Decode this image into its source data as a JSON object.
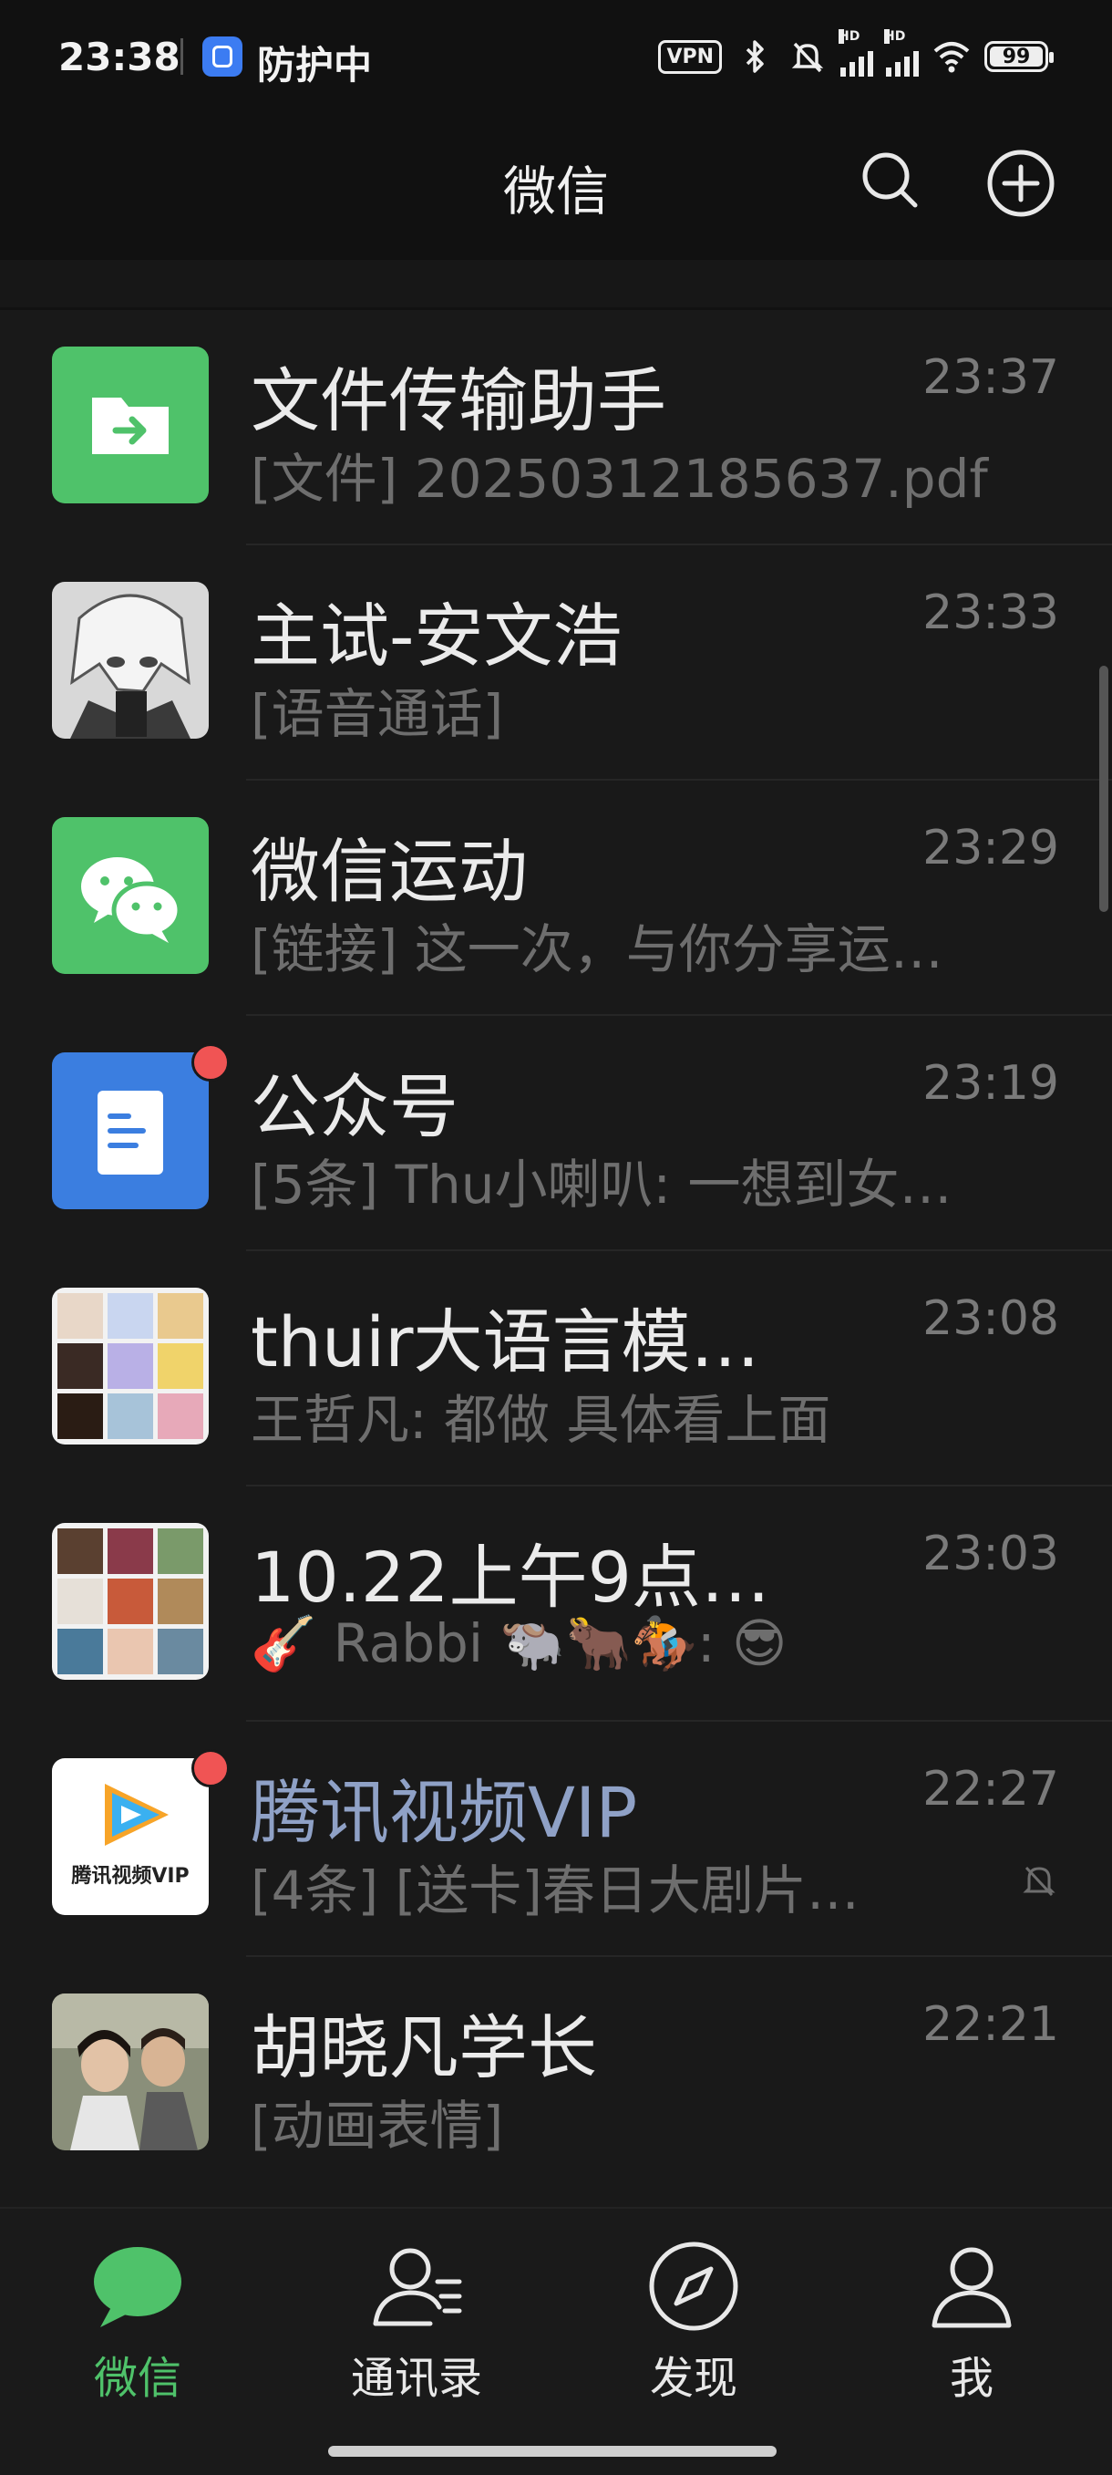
{
  "status_bar": {
    "time": "23:38",
    "protection": "防护中",
    "vpn": "VPN",
    "battery": "99"
  },
  "header": {
    "title": "微信"
  },
  "chats": [
    {
      "name": "文件传输助手",
      "preview": "[文件] 20250312185637.pdf",
      "time": "23:37",
      "avatar": "folder-transfer-icon",
      "color": "#4fc26a"
    },
    {
      "name": "主试-安文浩",
      "preview": "[语音通话]",
      "time": "23:33",
      "avatar": "anime-portrait"
    },
    {
      "name": "微信运动",
      "preview": "[链接] 这一次，与你分享运…",
      "time": "23:29",
      "avatar": "wechat-sport-icon",
      "color": "#4fc26a"
    },
    {
      "name": "公众号",
      "preview": "[5条] Thu小喇叭: 一想到女…",
      "time": "23:19",
      "avatar": "official-accounts-icon",
      "color": "#3b7ee0",
      "unread_dot": true
    },
    {
      "name": "thuir大语言模…",
      "preview": "王哲凡: 都做 具体看上面",
      "time": "23:08",
      "avatar": "group-grid"
    },
    {
      "name": "10.22上午9点…",
      "preview": "🎸 Rabbi 🐃🐂🏇: 😎",
      "time": "23:03",
      "avatar": "group-grid"
    },
    {
      "name": "腾讯视频VIP",
      "preview": "[4条] [送卡]春日大剧片…",
      "time": "22:27",
      "avatar": "tencent-video-vip-logo",
      "avatar_text": "腾讯视频VIP",
      "unread_dot": true,
      "muted": true
    },
    {
      "name": "胡晓凡学长",
      "preview": "[动画表情]",
      "time": "22:21",
      "avatar": "drama-photo"
    }
  ],
  "tabs": [
    {
      "label": "微信",
      "active": true
    },
    {
      "label": "通讯录"
    },
    {
      "label": "发现"
    },
    {
      "label": "我"
    }
  ],
  "colors": {
    "accent": "#4fc26a",
    "unread": "#f05454",
    "background": "#191919"
  }
}
